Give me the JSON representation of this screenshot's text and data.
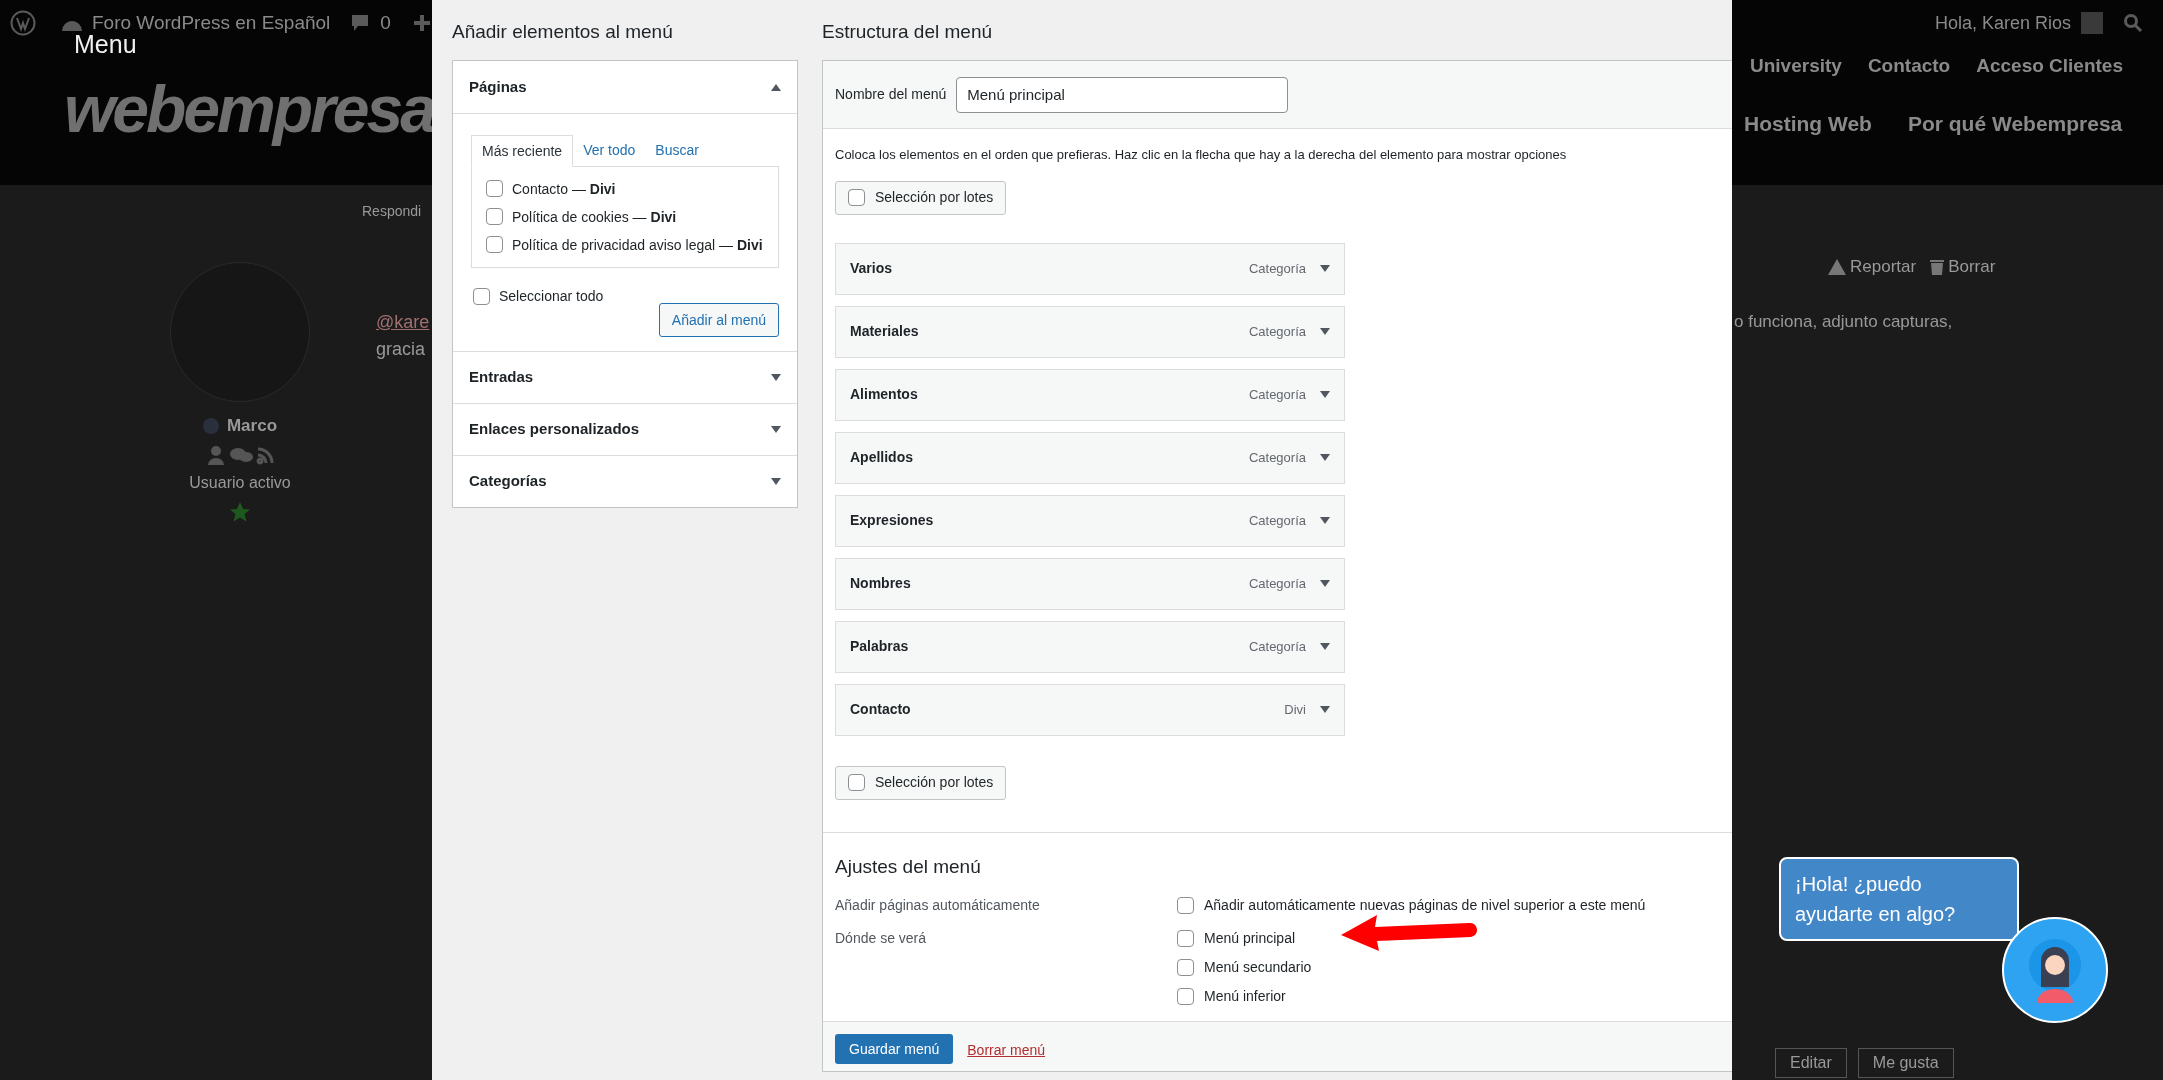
{
  "caption": "Menu",
  "admin_bar": {
    "site": "Foro WordPress en Español",
    "comments": "0",
    "greeting": "Hola, Karen Rios"
  },
  "site_header": {
    "logo": "webempresa",
    "nav_top": [
      "University",
      "Contacto",
      "Acceso Clientes"
    ],
    "nav_main": [
      "Hosting Web",
      "Por qué Webempresa"
    ]
  },
  "post": {
    "breadcrumb": "Respondi",
    "author": "Marco",
    "role": "Usuario activo",
    "mention": "@kare",
    "text_left": "gracia",
    "text_right": "o funciona, adjunto capturas,",
    "actions": [
      "Reportar",
      "Borrar"
    ],
    "buttons": [
      "Editar",
      "Me gusta"
    ]
  },
  "screenshot": {
    "add_items": {
      "title": "Añadir elementos al menú",
      "sections": [
        {
          "label": "Páginas",
          "expanded": true
        },
        {
          "label": "Entradas",
          "expanded": false
        },
        {
          "label": "Enlaces personalizados",
          "expanded": false
        },
        {
          "label": "Categorías",
          "expanded": false
        }
      ],
      "tabs": [
        {
          "label": "Más reciente",
          "selected": true
        },
        {
          "label": "Ver todo",
          "selected": false
        },
        {
          "label": "Buscar",
          "selected": false
        }
      ],
      "pages": [
        {
          "label": "Contacto — **Divi**",
          "checked": false
        },
        {
          "label": "Política de cookies — **Divi**",
          "checked": false
        },
        {
          "label": "Política de privacidad aviso legal — **Divi**",
          "checked": false
        }
      ],
      "select_all": {
        "label": "Seleccionar todo",
        "checked": false
      },
      "add_button": "Añadir al menú"
    },
    "structure": {
      "title": "Estructura del menú",
      "name_label": "Nombre del menú",
      "name_value": "Menú principal",
      "instructions": "Coloca los elementos en el orden que prefieras. Haz clic en la flecha que hay a la derecha del elemento para mostrar opciones",
      "bulk_select": [
        {
          "label": "Selección por lotes",
          "checked": false
        },
        {
          "label": "Selección por lotes",
          "checked": false
        }
      ],
      "items": [
        {
          "label": "Varios",
          "type": "Categoría"
        },
        {
          "label": "Materiales",
          "type": "Categoría"
        },
        {
          "label": "Alimentos",
          "type": "Categoría"
        },
        {
          "label": "Apellidos",
          "type": "Categoría"
        },
        {
          "label": "Expresiones",
          "type": "Categoría"
        },
        {
          "label": "Nombres",
          "type": "Categoría"
        },
        {
          "label": "Palabras",
          "type": "Categoría"
        },
        {
          "label": "Contacto",
          "type": "Divi"
        }
      ]
    },
    "settings": {
      "title": "Ajustes del menú",
      "rows": [
        {
          "label": "Añadir páginas automáticamente",
          "options": [
            {
              "label": "Añadir automáticamente nuevas páginas de nivel superior a este menú",
              "checked": false
            }
          ]
        },
        {
          "label": "Dónde se verá",
          "options": [
            {
              "label": "Menú principal",
              "checked": false
            },
            {
              "label": "Menú secundario",
              "checked": false
            },
            {
              "label": "Menú inferior",
              "checked": false
            }
          ]
        }
      ]
    },
    "save_button": "Guardar menú",
    "delete_link": "Borrar menú"
  },
  "chat": {
    "message": "¡Hola! ¿puedo ayudarte en algo?"
  }
}
